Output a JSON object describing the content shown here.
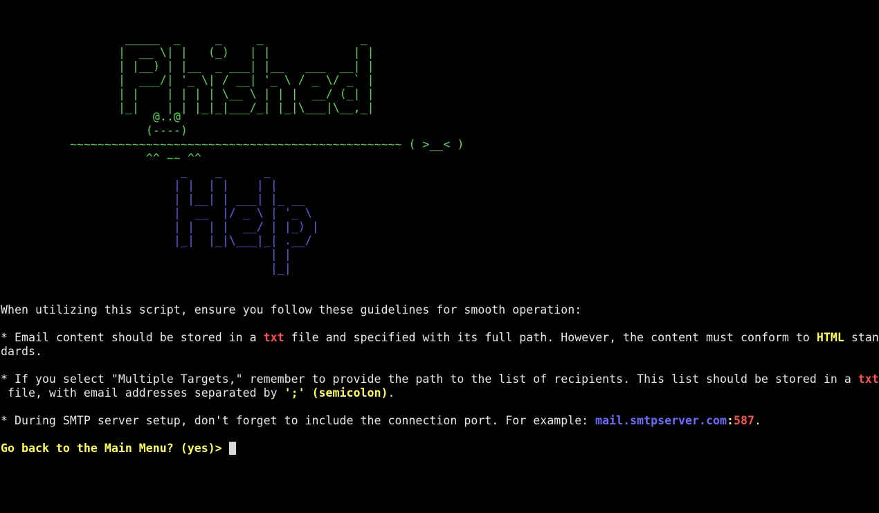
{
  "banner": {
    "title_art": "  _____  _     _     _              _ \n |  __ \\| |   (_)   | |            | |\n | |__) | |__  _ ___| |__   ___  __| |\n |  ___/| '_ \\| / __| '_ \\ / _ \\/ _` |\n | |    | | | | \\__ \\ | | |  __/ (_| |\n |_|    |_| |_|_|___/_| |_|\\___|\\__,_|",
    "mascot_art": "            @..@\n           (----)\n~~~~~~~~~~~~~~~~~~~~~~~~~~~~~~~~~~~~~~~~~~~~~~~~ ( >__< )\n           ^^ ~~ ^^",
    "help_art": "  _    _      _       \n | |  | |    | |      \n | |__| | ___| |_ __  \n |  __  |/ _ \\ | '_ \\ \n | |  | |  __/ | |_) |\n |_|  |_|\\___|_| .__/ \n               | |    \n               |_|    "
  },
  "intro": "When utilizing this script, ensure you follow these guidelines for smooth operation:",
  "guideline1": {
    "before": "* Email content should be stored in a ",
    "txt": "txt",
    "middle": " file and specified with its full path. However, the content must conform to ",
    "html": "HTML",
    "after": " stan",
    "wrap": "dards."
  },
  "guideline2": {
    "before": "* If you select \"Multiple Targets,\" remember to provide the path to the list of recipients. This list should be stored in a ",
    "txt": "txt",
    "wrap_before": " file, with email addresses separated by ",
    "semicolon": "';' (semicolon)",
    "end": "."
  },
  "guideline3": {
    "before": "* During SMTP server setup, don't forget to include the connection port. For example: ",
    "host": "mail.smtpserver.com",
    "colon": ":",
    "port": "587",
    "end": "."
  },
  "prompt": "Go back to the Main Menu? (yes)> "
}
